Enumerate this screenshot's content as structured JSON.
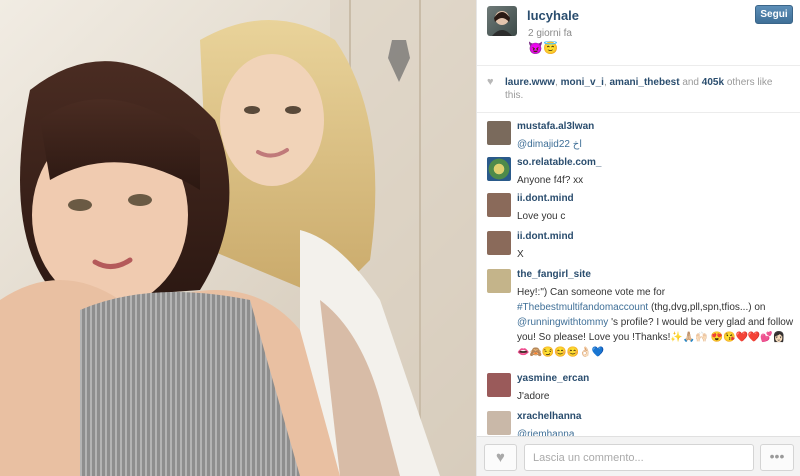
{
  "post": {
    "username": "lucyhale",
    "time": "2 giorni fa",
    "caption": "😈😇",
    "follow_label": "Segui"
  },
  "likes": {
    "users": [
      "laure.www",
      "moni_v_i",
      "amani_thebest"
    ],
    "and_text": "and",
    "count": "405k",
    "others_text": "others like this."
  },
  "comments": [
    {
      "user": "mustafa.al3lwan",
      "text": "@dimajid22 اخ",
      "avatar_color": "#7a6a5c"
    },
    {
      "user": "so.relatable.com_",
      "text": "Anyone f4f? xx",
      "avatar_color": "#4e8a4a"
    },
    {
      "user": "ii.dont.mind",
      "text": "Love you c",
      "avatar_color": "#8a6a5a"
    },
    {
      "user": "ii.dont.mind",
      "text": "X",
      "avatar_color": "#8a6a5a"
    },
    {
      "user": "the_fangirl_site",
      "text_parts": [
        "Hey!:\") Can someone vote me for ",
        "#Thebestmultifandomaccount",
        " (thg,dvg,pll,spn,tfios...) on ",
        "@runningwithtommy",
        " 's profile? I would be very glad and follow you! So please! Love you !Thanks!✨🙏🏼🙌🏻 😍😘❤️❤️💕👩🏻👄🙈😏😊😊👌🏻💙"
      ],
      "avatar_color": "#c4b48a"
    },
    {
      "user": "yasmine_ercan",
      "text": "J'adore",
      "avatar_color": "#9a5a5a"
    },
    {
      "user": "xrachelhanna",
      "text": "@riemhanna",
      "avatar_color": "#c9b8a8"
    }
  ],
  "footer": {
    "comment_placeholder": "Lascia un commento..."
  },
  "icons": {
    "heart": "heart-icon",
    "more": "ellipsis-icon"
  }
}
